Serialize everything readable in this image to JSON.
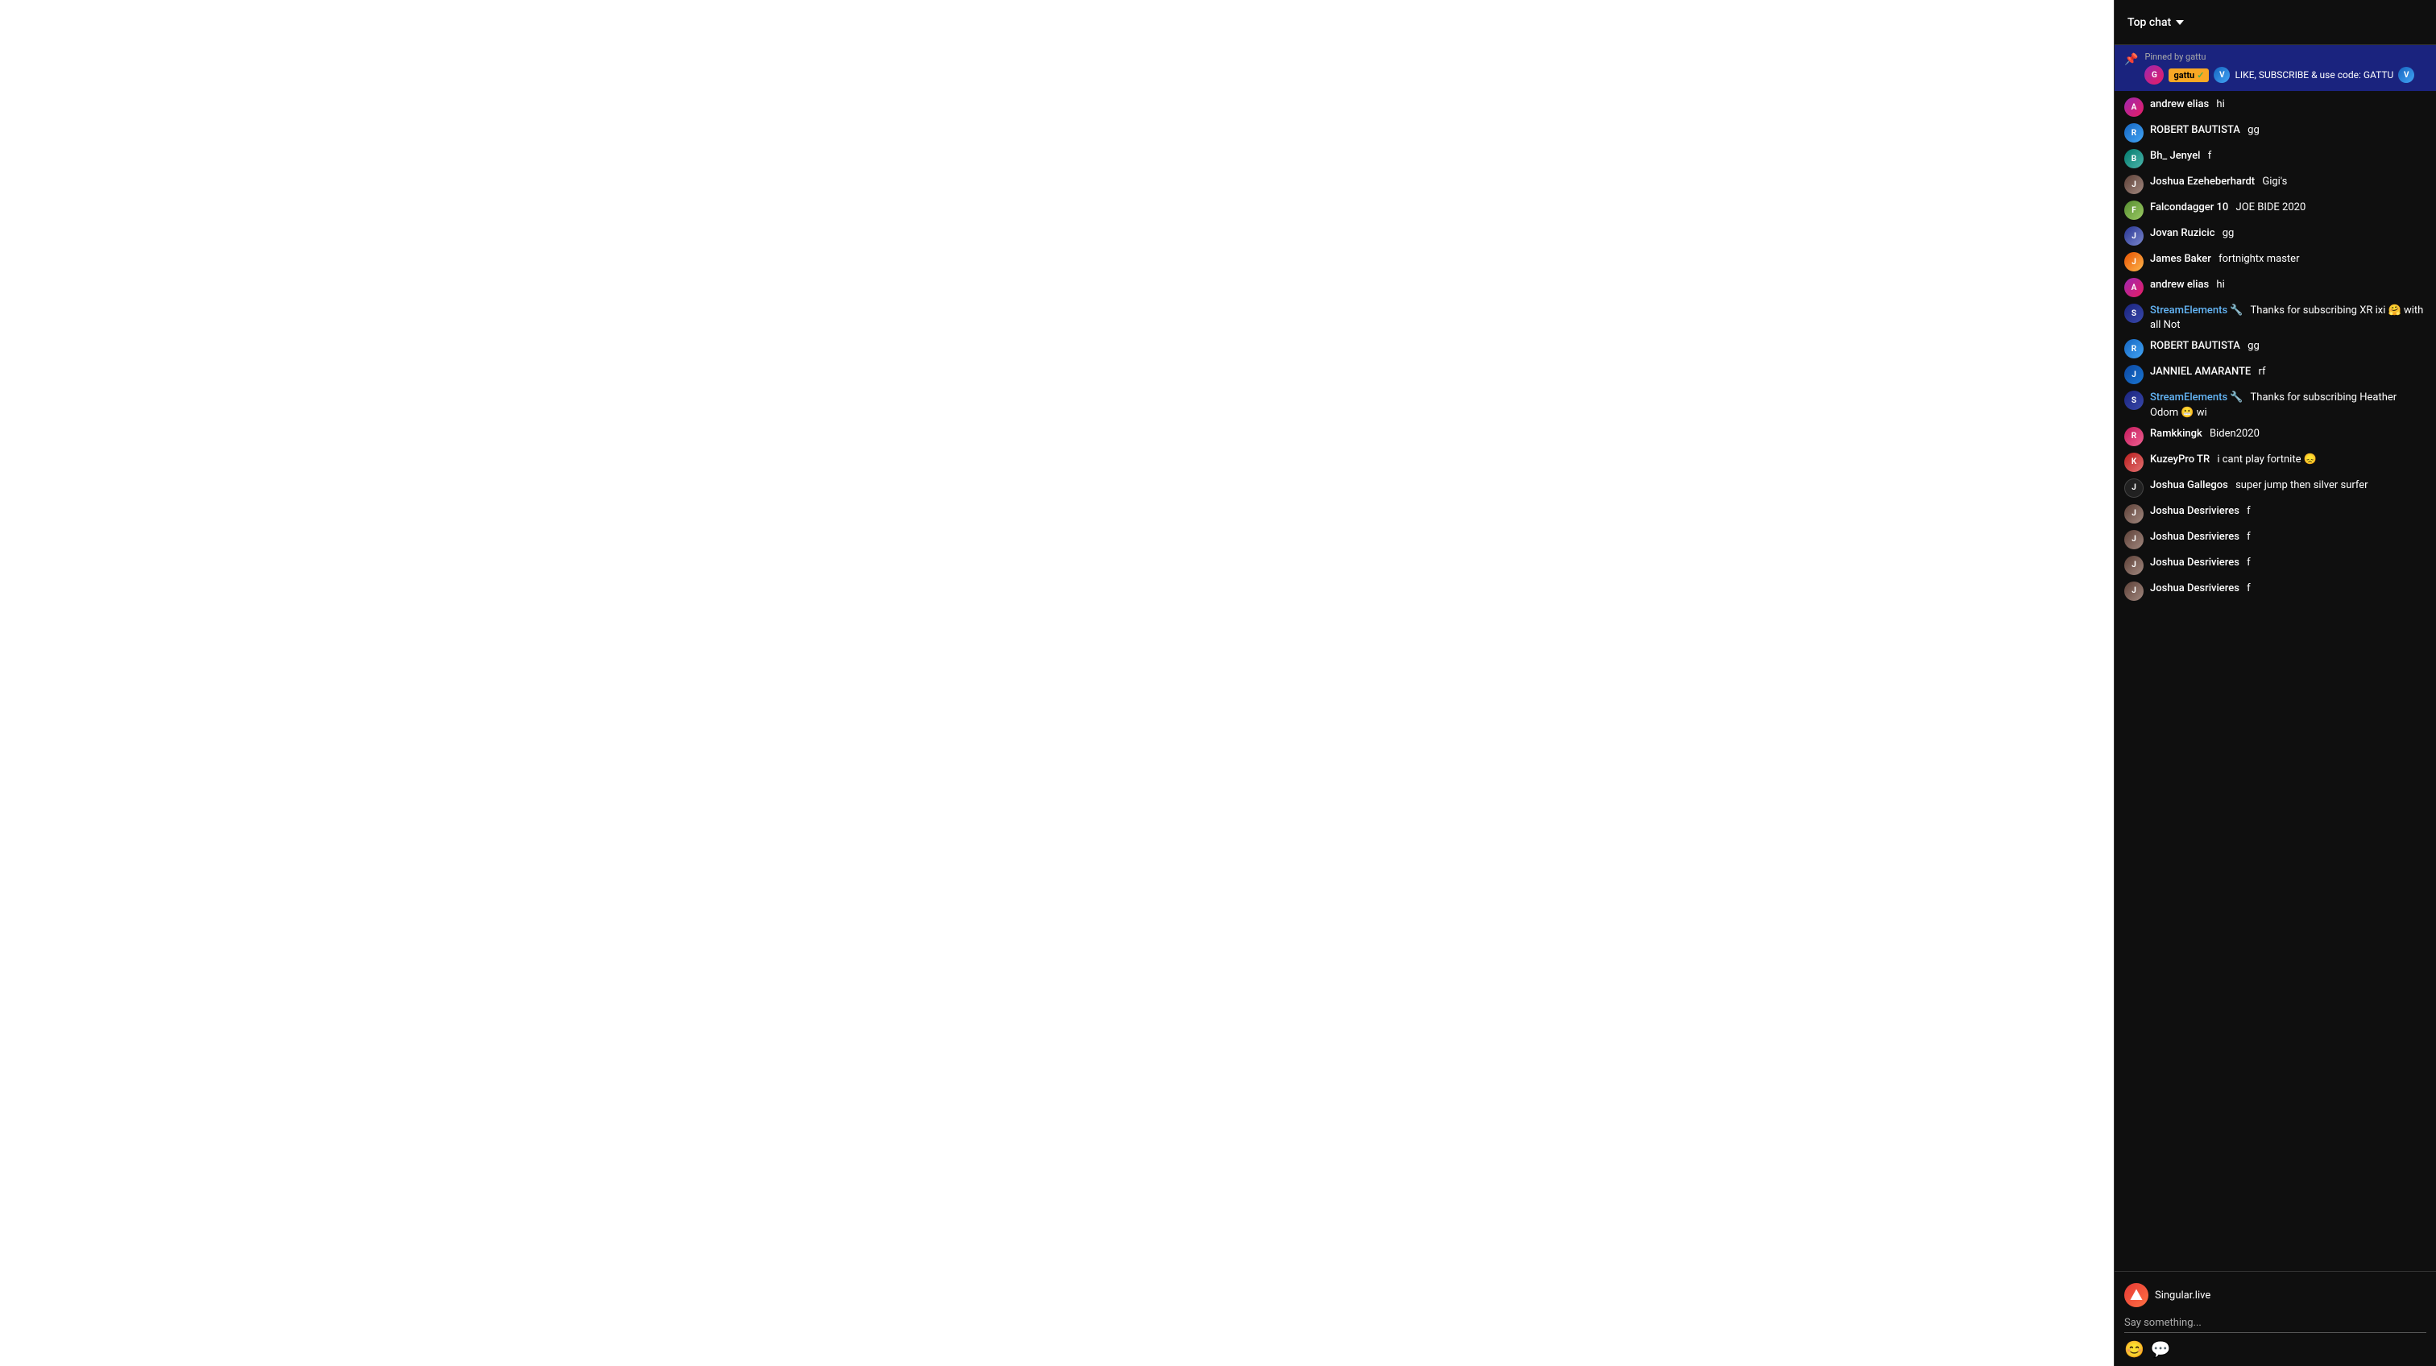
{
  "header": {
    "title": "Top chat",
    "dropdown_label": "Top chat"
  },
  "pinned": {
    "pinned_by": "Pinned by gattu",
    "username": "gattu",
    "checkmark": "✓",
    "message": "LIKE, SUBSCRIBE & use code: GATTU"
  },
  "messages": [
    {
      "id": 1,
      "username": "andrew elias",
      "message": "hi",
      "avatar_class": "av-purple",
      "initials": "A",
      "is_stream": false
    },
    {
      "id": 2,
      "username": "ROBERT BAUTISTA",
      "message": "gg",
      "avatar_class": "av-blue",
      "initials": "R",
      "is_stream": false
    },
    {
      "id": 3,
      "username": "Bh_ Jenyel",
      "message": "f",
      "avatar_class": "av-teal",
      "initials": "B",
      "is_stream": false
    },
    {
      "id": 4,
      "username": "Joshua Ezeheberhardt",
      "message": "Gigi's",
      "avatar_class": "av-brown",
      "initials": "J",
      "is_stream": false
    },
    {
      "id": 5,
      "username": "Falcondagger 10",
      "message": "JOE BIDE 2020",
      "avatar_class": "av-olive",
      "initials": "F",
      "is_stream": false
    },
    {
      "id": 6,
      "username": "Jovan Ruzicic",
      "message": "gg",
      "avatar_class": "av-indigo",
      "initials": "J",
      "is_stream": false
    },
    {
      "id": 7,
      "username": "James Baker",
      "message": "fortnightx master",
      "avatar_class": "av-orange",
      "initials": "J",
      "is_stream": false
    },
    {
      "id": 8,
      "username": "andrew elias",
      "message": "hi",
      "avatar_class": "av-purple",
      "initials": "A",
      "is_stream": false
    },
    {
      "id": 9,
      "username": "StreamElements 🔧",
      "message": "Thanks for subscribing XR ixi 🤗 with all Not",
      "avatar_class": "av-stream",
      "initials": "S",
      "is_stream": true
    },
    {
      "id": 10,
      "username": "ROBERT BAUTISTA",
      "message": "gg",
      "avatar_class": "av-blue",
      "initials": "R",
      "is_stream": false
    },
    {
      "id": 11,
      "username": "JANNIEL AMARANTE",
      "message": "rf",
      "avatar_class": "av-dark-blue",
      "initials": "J",
      "is_stream": false
    },
    {
      "id": 12,
      "username": "StreamElements 🔧",
      "message": "Thanks for subscribing Heather Odom 😬 wi",
      "avatar_class": "av-stream",
      "initials": "S",
      "is_stream": true
    },
    {
      "id": 13,
      "username": "Ramkkingk",
      "message": "Biden2020",
      "avatar_class": "av-pink",
      "initials": "R",
      "is_stream": false
    },
    {
      "id": 14,
      "username": "KuzeyPro TR",
      "message": "i cant play fortnite 😞",
      "avatar_class": "av-red",
      "initials": "K",
      "is_stream": false
    },
    {
      "id": 15,
      "username": "Joshua Gallegos",
      "message": "super jump then silver surfer",
      "avatar_class": "av-dark",
      "initials": "J",
      "is_stream": false
    },
    {
      "id": 16,
      "username": "Joshua Desrivieres",
      "message": "f",
      "avatar_class": "av-brown",
      "initials": "J",
      "is_stream": false
    },
    {
      "id": 17,
      "username": "Joshua Desrivieres",
      "message": "f",
      "avatar_class": "av-brown",
      "initials": "J",
      "is_stream": false
    },
    {
      "id": 18,
      "username": "Joshua Desrivieres",
      "message": "f",
      "avatar_class": "av-brown",
      "initials": "J",
      "is_stream": false
    },
    {
      "id": 19,
      "username": "Joshua Desrivieres",
      "message": "f",
      "avatar_class": "av-brown",
      "initials": "J",
      "is_stream": false
    }
  ],
  "footer": {
    "account_name": "Singular.live",
    "say_something_placeholder": "Say something...",
    "emoji_icon": "😊",
    "chat_icon": "💬"
  }
}
